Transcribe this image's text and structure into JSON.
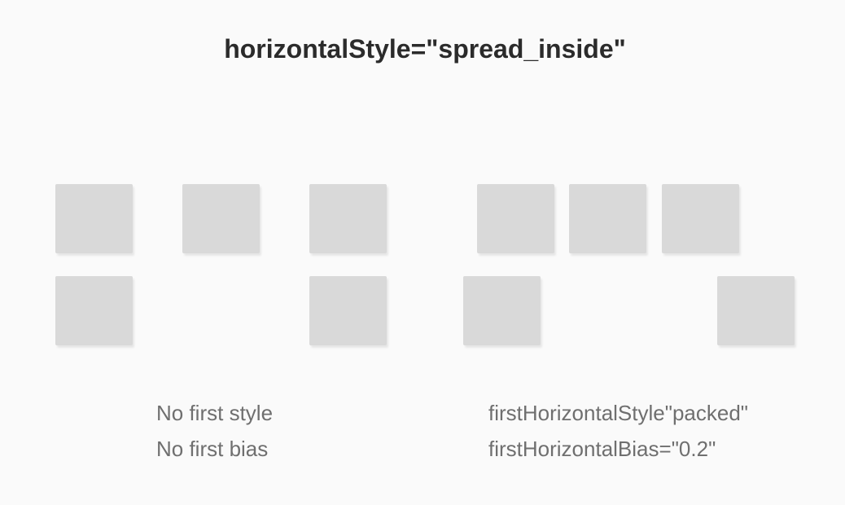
{
  "title": "horizontalStyle=\"spread_inside\"",
  "left_example": {
    "row1_boxes": 3,
    "row2_boxes": 2,
    "caption": {
      "line1": "No first style",
      "line2": "No first bias"
    }
  },
  "right_example": {
    "row1_boxes": 3,
    "row2_boxes": 2,
    "caption": {
      "line1": "firstHorizontalStyle\"packed\"",
      "line2": "firstHorizontalBias=\"0.2\""
    }
  },
  "colors": {
    "background": "#fafafa",
    "box": "#d9d9d9",
    "title_text": "#2b2b2b",
    "caption_text": "#6f6f6f"
  }
}
